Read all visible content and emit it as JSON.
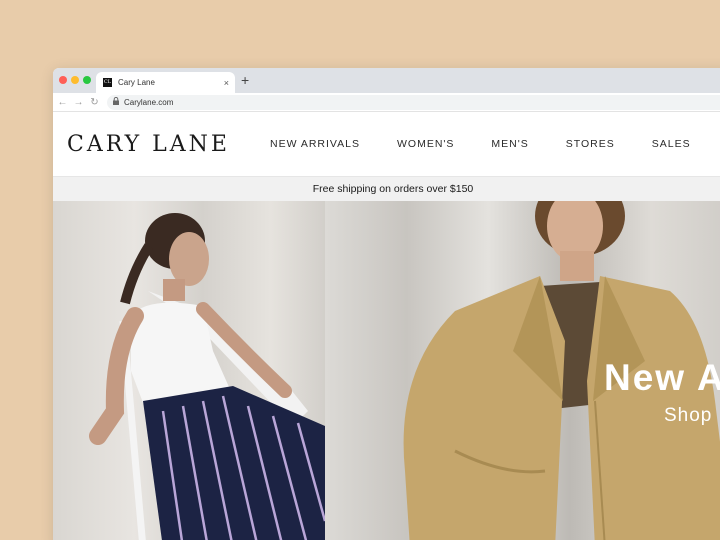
{
  "browser": {
    "tab": {
      "title": "Cary Lane",
      "favicon_text": "CL"
    },
    "new_tab_label": "+",
    "close_glyph": "×",
    "url": "Carylane.com"
  },
  "site": {
    "logo": "CARY LANE",
    "nav": [
      "NEW ARRIVALS",
      "WOMEN'S",
      "MEN'S",
      "STORES",
      "SALES"
    ],
    "promo": "Free shipping on orders over $150"
  },
  "hero": {
    "title": "New A",
    "cta": "Shop"
  },
  "colors": {
    "background": "#e8ccaa",
    "traffic_red": "#ff5f57",
    "traffic_yellow": "#febc2e",
    "traffic_green": "#28c840"
  },
  "icons": [
    "back-arrow-icon",
    "forward-arrow-icon",
    "reload-icon",
    "lock-icon",
    "close-icon",
    "plus-icon"
  ]
}
